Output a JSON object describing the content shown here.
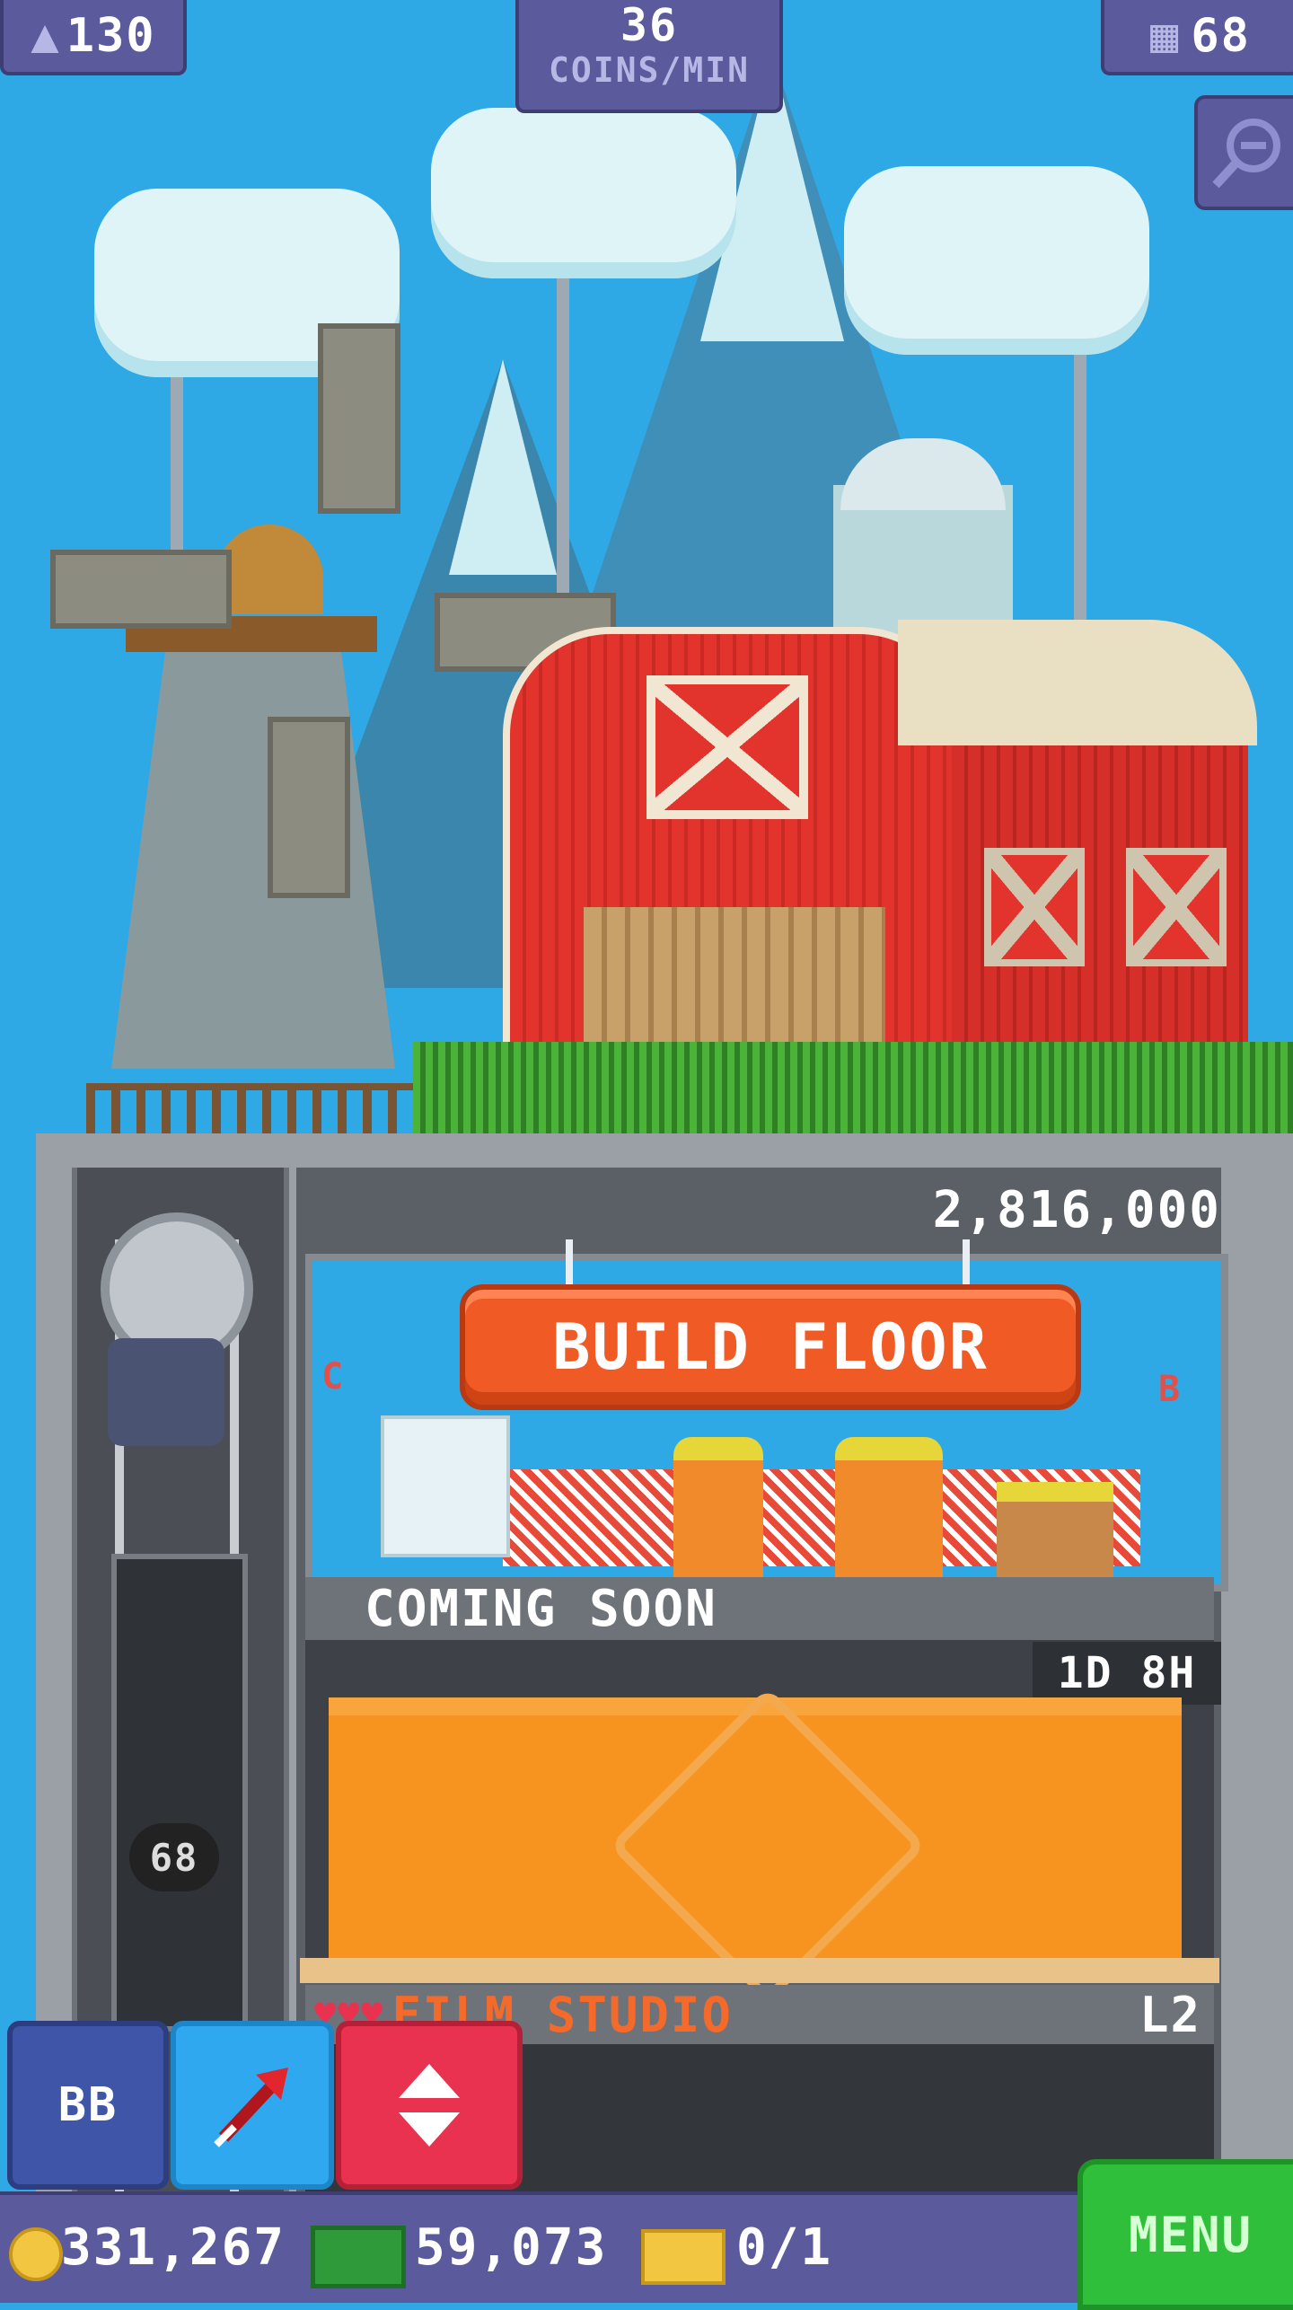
{
  "hud": {
    "population": "130",
    "coins_rate_value": "36",
    "coins_rate_label": "COINS/MIN",
    "floors": "68"
  },
  "tower": {
    "build_cost": "2,816,000",
    "build_button": "BUILD FLOOR",
    "left_letter": "C",
    "right_letter": "B",
    "coming_soon": "COMING SOON",
    "timer": "1D 8H",
    "elevator_floor": "68",
    "floor_name": "FILM STUDIO",
    "floor_level": "L2"
  },
  "toolbar": {
    "bb_label": "BB"
  },
  "bottom": {
    "coins": "331,267",
    "bux": "59,073",
    "tickets": "0/1",
    "menu": "MENU"
  },
  "icons": [
    "person-icon",
    "building-icon",
    "zoom-out-icon",
    "arrow-icon",
    "up-down-arrows-icon",
    "coin-icon",
    "bux-icon",
    "ticket-icon",
    "heart-icon"
  ],
  "colors": {
    "sky": "#2fa8e6",
    "hud": "#5a5a9c",
    "build_button": "#f05a24",
    "menu": "#2fbf3a",
    "elevator_button": "#e8324f"
  }
}
